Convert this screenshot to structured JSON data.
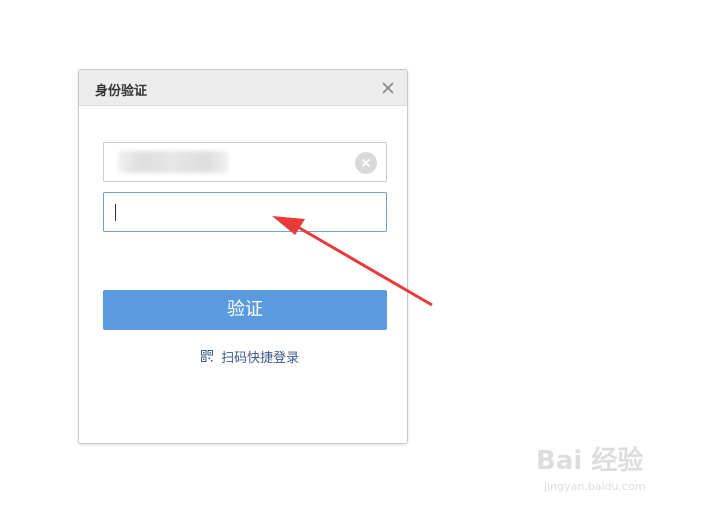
{
  "dialog": {
    "title": "身份验证",
    "close_icon": "close-icon",
    "account_field": {
      "value": "",
      "value_obscured": true,
      "clear_icon": "clear-circle-x-icon"
    },
    "password_field": {
      "value": "",
      "focused": true
    },
    "submit_label": "验证",
    "qr_login": {
      "icon": "qr-code-icon",
      "label": "扫码快捷登录"
    }
  },
  "annotation": {
    "type": "red-arrow",
    "color": "#e83a3a",
    "points_to": "password-field"
  },
  "watermark": {
    "brand": "Bai 经验",
    "url": "jingyan.baidu.com"
  },
  "colors": {
    "primary_button": "#5a9be0",
    "header_bg": "#ececec",
    "link_text": "#3c5a8a",
    "focused_border": "#6f9fd3"
  }
}
